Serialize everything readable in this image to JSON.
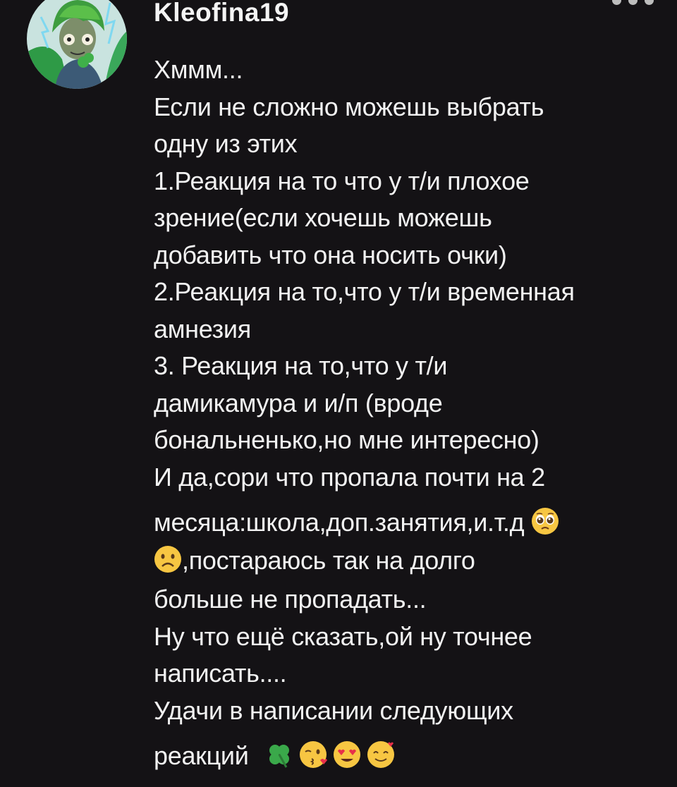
{
  "comment": {
    "username": "Kleofina19",
    "lines": [
      "Хммм...",
      "Если не сложно можешь выбрать",
      "одну из этих",
      "1.Реакция на то что у т/и плохое",
      "зрение(если хочешь можешь",
      "добавить что она носить очки)",
      "2.Реакция на то,что у т/и временная",
      "амнезия",
      "3. Реакция на то,что у т/и",
      "дамикамура и и/п (вроде",
      "бональненько,но мне интересно)",
      "И да,сори что пропала почти на 2",
      "месяца:школа,доп.занятия,и.т.д",
      ",постараюсь так на долго",
      "больше не пропадать...",
      "Ну что ещё сказать,ой ну точнее",
      "написать....",
      "Удачи в написании следующих",
      "реакций"
    ],
    "emojis": {
      "pleading": "pleading-face-icon",
      "frowning": "frowning-face-icon",
      "clover": "four-leaf-clover-icon",
      "kiss": "face-blowing-kiss-icon",
      "heart_eyes": "heart-eyes-face-icon",
      "hearts": "smiling-face-with-hearts-icon"
    }
  }
}
